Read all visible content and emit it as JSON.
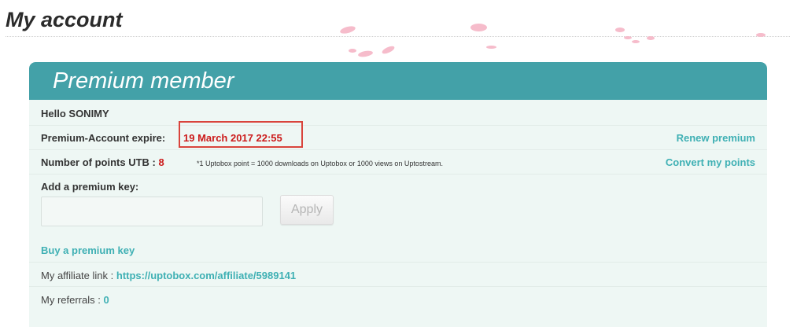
{
  "page": {
    "title": "My account"
  },
  "panel": {
    "title": "Premium member"
  },
  "greeting": {
    "text": "Hello SONIMY"
  },
  "expire": {
    "label": "Premium-Account expire:",
    "value": "19 March 2017 22:55",
    "renew_label": "Renew premium"
  },
  "points": {
    "label": "Number of points UTB :",
    "value": "8",
    "note": "*1 Uptobox point = 1000 downloads on Uptobox or 1000 views on Uptostream.",
    "convert_label": "Convert my points"
  },
  "premium_key": {
    "label": "Add a premium key:",
    "input_value": "",
    "apply_label": "Apply"
  },
  "buy_key": {
    "label": "Buy a premium key"
  },
  "affiliate": {
    "label": "My affiliate link :",
    "url": "https://uptobox.com/affiliate/5989141"
  },
  "referrals": {
    "label": "My referrals :",
    "value": "0"
  },
  "colors": {
    "header": "#43a1a8",
    "panel_bg": "#eef7f4",
    "link": "#3fb0b4",
    "expire": "#cc1a1a",
    "highlight_box": "#d9443c"
  }
}
